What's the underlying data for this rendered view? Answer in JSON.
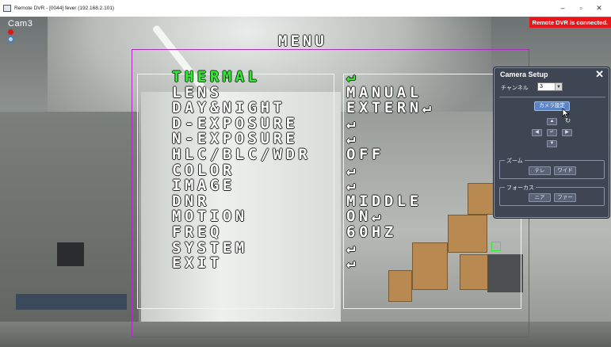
{
  "window": {
    "title": "Remote DVR - [0044] fever (192.168.2.101)",
    "minimize": "–",
    "maximize": "▫",
    "close": "✕"
  },
  "video": {
    "camera_label": "Cam3",
    "status": "Remote DVR is connected."
  },
  "osd": {
    "title": "MENU",
    "items": [
      {
        "label": "THERMAL",
        "value": "↵",
        "active": true
      },
      {
        "label": "LENS",
        "value": "MANUAL"
      },
      {
        "label": "DAY&NIGHT",
        "value": "EXTERN↵"
      },
      {
        "label": "D-EXPOSURE",
        "value": "↵"
      },
      {
        "label": "N-EXPOSURE",
        "value": "↵"
      },
      {
        "label": "HLC/BLC/WDR",
        "value": "OFF"
      },
      {
        "label": "COLOR",
        "value": "↵"
      },
      {
        "label": "IMAGE",
        "value": "↵"
      },
      {
        "label": "DNR",
        "value": "MIDDLE"
      },
      {
        "label": "MOTION",
        "value": "ON↵"
      },
      {
        "label": "FREQ",
        "value": "60HZ"
      },
      {
        "label": "SYSTEM",
        "value": "↵"
      },
      {
        "label": "EXIT",
        "value": "↵"
      }
    ],
    "active_color": "#36e83a"
  },
  "camera_setup": {
    "title": "Camera Setup",
    "close": "✕",
    "channel_label": "チャンネル",
    "channel_value": "3",
    "camera_settings_button": "カメラ設定",
    "pad": {
      "up": "▲",
      "down": "▼",
      "left": "◀",
      "right": "▶",
      "enter": "↵",
      "refresh": "↻"
    },
    "zoom": {
      "label": "ズーム",
      "tele": "テレ",
      "wide": "ワイド"
    },
    "focus": {
      "label": "フォーカス",
      "near": "ニア",
      "far": "ファー"
    }
  }
}
